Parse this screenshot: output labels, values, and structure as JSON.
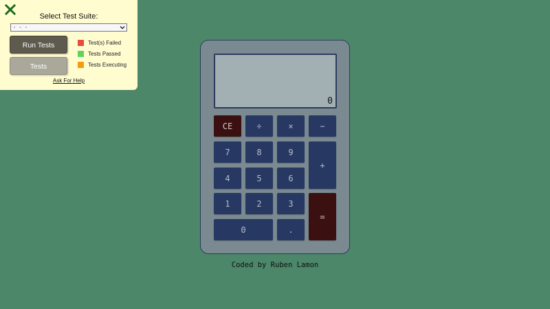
{
  "test_panel": {
    "close_icon": "close-x-icon",
    "title": "Select Test Suite:",
    "suite_select": {
      "selected": "- - -"
    },
    "run_button": "Run Tests",
    "tests_button": "Tests",
    "legend": [
      {
        "label": "Test(s) Failed",
        "color": "#e74c3c"
      },
      {
        "label": "Tests Passed",
        "color": "#5fd35f"
      },
      {
        "label": "Tests Executing",
        "color": "#f39c12"
      }
    ],
    "help_link": "Ask For Help"
  },
  "calculator": {
    "display": "0",
    "keys": {
      "clear": "CE",
      "divide": "÷",
      "multiply": "×",
      "subtract": "−",
      "seven": "7",
      "eight": "8",
      "nine": "9",
      "add": "+",
      "four": "4",
      "five": "5",
      "six": "6",
      "one": "1",
      "two": "2",
      "three": "3",
      "equals": "=",
      "zero": "0",
      "decimal": "."
    }
  },
  "footer": {
    "credit": "Coded by Ruben Lamon"
  },
  "colors": {
    "background": "#4c8769",
    "panel": "#fffcd0",
    "calculator_body": "#7a8a90",
    "display": "#a3b0b3",
    "key": "#273862",
    "key_danger": "#3b1010",
    "close_icon": "#1b6a1b"
  }
}
